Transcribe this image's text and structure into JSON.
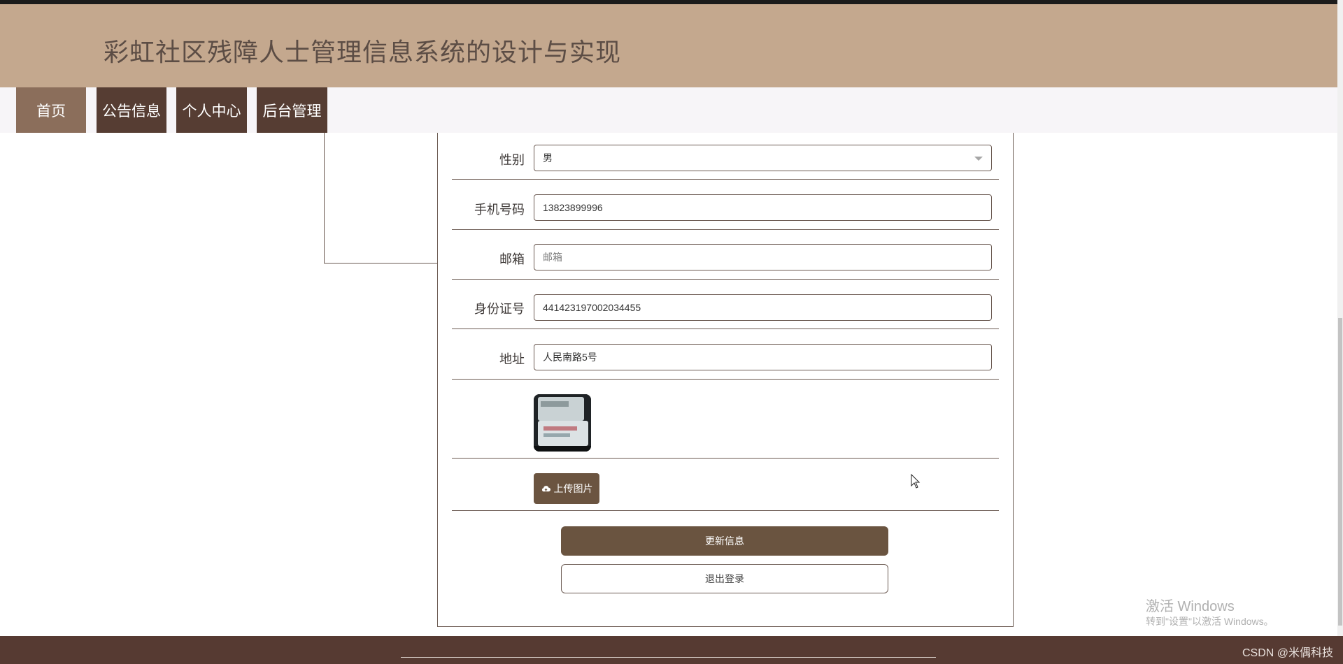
{
  "header": {
    "title": "彩虹社区残障人士管理信息系统的设计与实现"
  },
  "nav": {
    "items": [
      {
        "label": "首页",
        "active": true
      },
      {
        "label": "公告信息",
        "active": false
      },
      {
        "label": "个人中心",
        "active": false
      },
      {
        "label": "后台管理",
        "active": false
      }
    ]
  },
  "form": {
    "gender": {
      "label": "性别",
      "value": "男"
    },
    "phone": {
      "label": "手机号码",
      "value": "13823899996"
    },
    "email": {
      "label": "邮箱",
      "value": "",
      "placeholder": "邮箱"
    },
    "id_card": {
      "label": "身份证号",
      "value": "441423197002034455"
    },
    "address": {
      "label": "地址",
      "value": "人民南路5号"
    },
    "upload_label": "上传图片",
    "update_label": "更新信息",
    "logout_label": "退出登录"
  },
  "watermark": {
    "title": "激活 Windows",
    "subtitle": "转到\"设置\"以激活 Windows。"
  },
  "footer": {
    "credit": "CSDN @米偶科技"
  },
  "colors": {
    "header_bg": "#c4a88e",
    "nav_bg": "#563d33",
    "nav_active_bg": "#8b6e5b",
    "primary_button": "#6a5440",
    "footer_bg": "#563a32"
  }
}
